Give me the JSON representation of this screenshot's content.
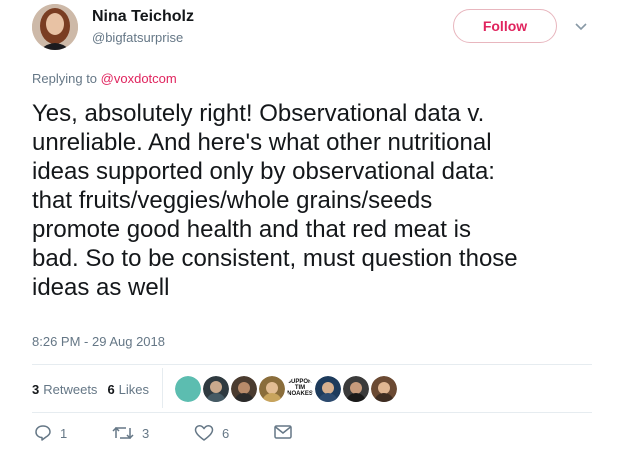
{
  "author": {
    "name": "Nina Teicholz",
    "handle": "@bigfatsurprise"
  },
  "follow_label": "Follow",
  "reply_context": {
    "prefix": "Replying to ",
    "target": "@voxdotcom"
  },
  "tweet_lines": [
    "Yes, absolutely right! Observational data v.",
    "unreliable. And here's what other nutritional",
    "ideas supported only by observational data:",
    "that fruits/veggies/whole grains/seeds",
    "promote good health and that red meat is",
    "bad. So to be consistent, must question those",
    "ideas as well"
  ],
  "timestamp": "8:26 PM - 29 Aug 2018",
  "stats": {
    "retweets_count": "3",
    "retweets_label": "Retweets",
    "likes_count": "6",
    "likes_label": "Likes"
  },
  "liker_badge": {
    "line1": "SUPPORT",
    "line2": "TIM",
    "line3": "NOAKES"
  },
  "actions": {
    "reply_count": "1",
    "retweet_count": "3",
    "like_count": "6"
  },
  "colors": {
    "accent": "#e0245e",
    "muted": "#657786",
    "text": "#14171a",
    "divider": "#e6ecf0"
  },
  "icons": [
    "chevron-down-icon",
    "reply-icon",
    "retweet-icon",
    "heart-icon",
    "message-icon"
  ]
}
